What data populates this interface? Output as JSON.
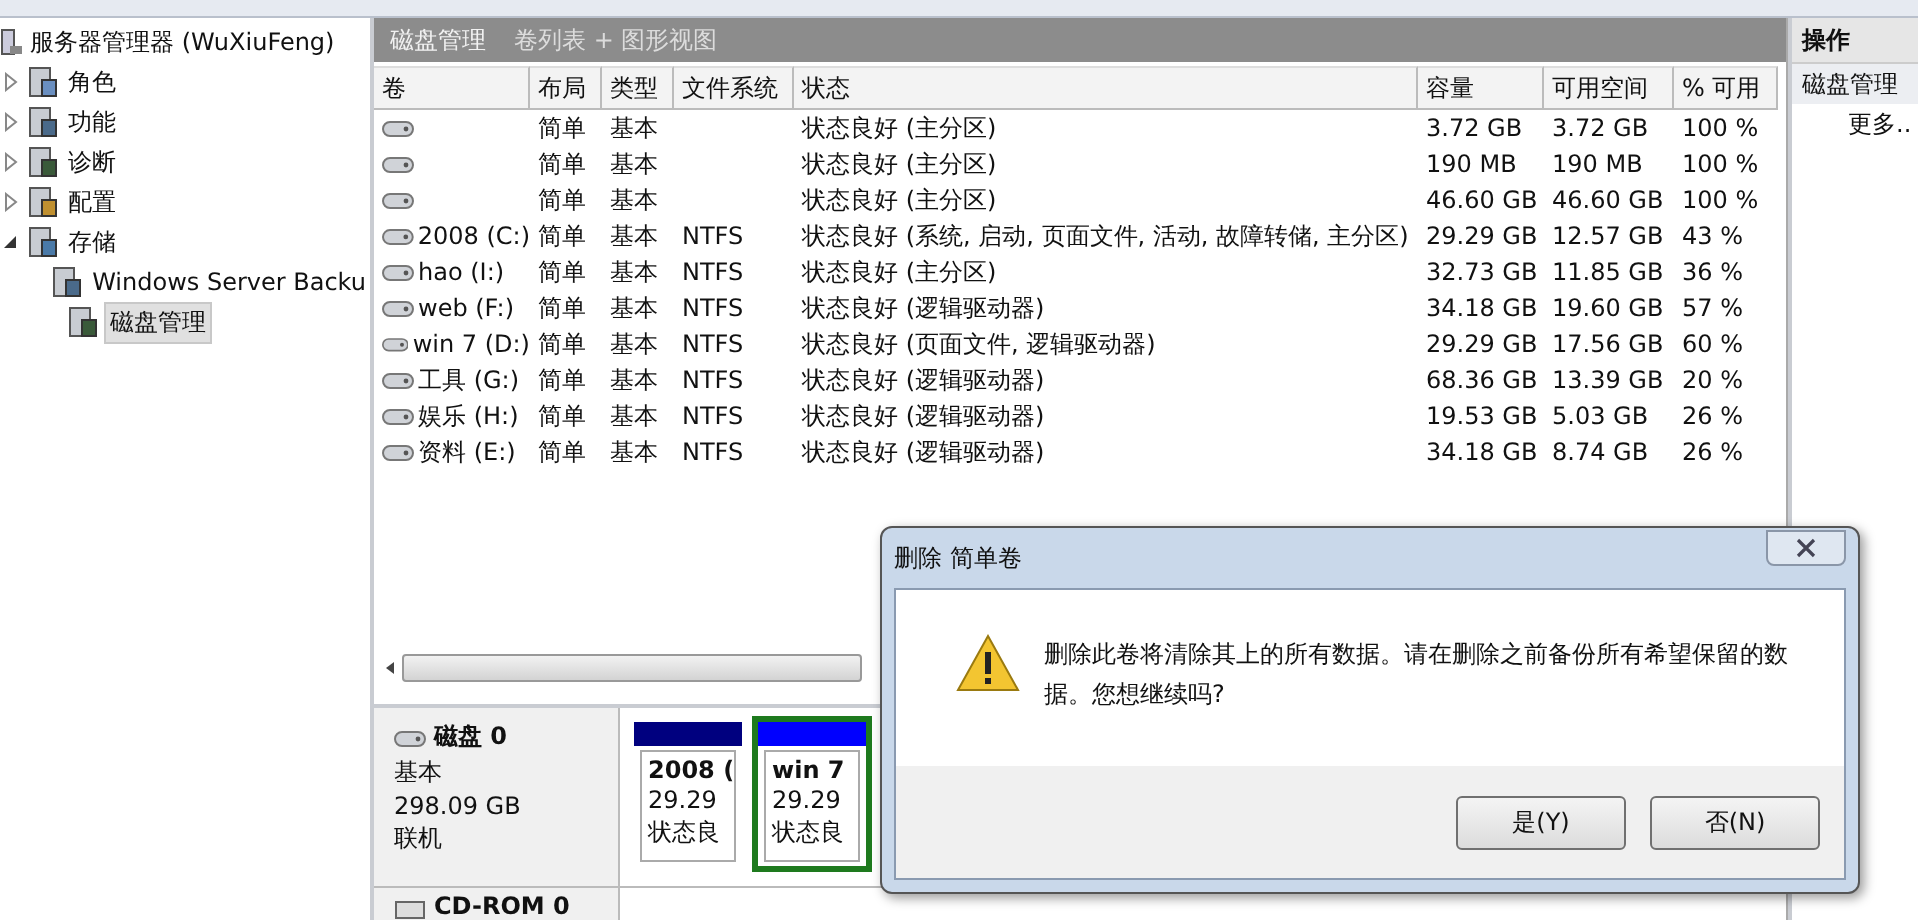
{
  "tree": {
    "root": "服务器管理器 (WuXiuFeng)",
    "items": [
      {
        "label": "角色",
        "expanded": false,
        "selected": false
      },
      {
        "label": "功能",
        "expanded": false,
        "selected": false
      },
      {
        "label": "诊断",
        "expanded": false,
        "selected": false
      },
      {
        "label": "配置",
        "expanded": false,
        "selected": false
      },
      {
        "label": "存储",
        "expanded": true,
        "selected": false,
        "children": [
          {
            "label": "Windows Server Backu",
            "selected": false
          },
          {
            "label": "磁盘管理",
            "selected": true
          }
        ]
      }
    ]
  },
  "panel": {
    "title": "磁盘管理",
    "subtitle": "卷列表 + 图形视图"
  },
  "table": {
    "columns": [
      "卷",
      "布局",
      "类型",
      "文件系统",
      "状态",
      "容量",
      "可用空间",
      "% 可用"
    ],
    "rows": [
      {
        "layout": "简单",
        "type": "基本",
        "status": "状态良好 (主分区)",
        "capacity": "3.72 GB",
        "free": "3.72 GB",
        "pct_free": "100 %"
      },
      {
        "layout": "简单",
        "type": "基本",
        "status": "状态良好 (主分区)",
        "capacity": "190 MB",
        "free": "190 MB",
        "pct_free": "100 %"
      },
      {
        "layout": "简单",
        "type": "基本",
        "status": "状态良好 (主分区)",
        "capacity": "46.60 GB",
        "free": "46.60 GB",
        "pct_free": "100 %"
      },
      {
        "volume": "2008 (C:)",
        "layout": "简单",
        "type": "基本",
        "fs": "NTFS",
        "status": "状态良好 (系统, 启动, 页面文件, 活动, 故障转储, 主分区)",
        "capacity": "29.29 GB",
        "free": "12.57 GB",
        "pct_free": "43 %"
      },
      {
        "volume": "hao (I:)",
        "layout": "简单",
        "type": "基本",
        "fs": "NTFS",
        "status": "状态良好 (主分区)",
        "capacity": "32.73 GB",
        "free": "11.85 GB",
        "pct_free": "36 %"
      },
      {
        "volume": "web (F:)",
        "layout": "简单",
        "type": "基本",
        "fs": "NTFS",
        "status": "状态良好 (逻辑驱动器)",
        "capacity": "34.18 GB",
        "free": "19.60 GB",
        "pct_free": "57 %"
      },
      {
        "volume": "win 7 (D:)",
        "layout": "简单",
        "type": "基本",
        "fs": "NTFS",
        "status": "状态良好 (页面文件, 逻辑驱动器)",
        "capacity": "29.29 GB",
        "free": "17.56 GB",
        "pct_free": "60 %"
      },
      {
        "volume": "工具 (G:)",
        "layout": "简单",
        "type": "基本",
        "fs": "NTFS",
        "status": "状态良好 (逻辑驱动器)",
        "capacity": "68.36 GB",
        "free": "13.39 GB",
        "pct_free": "20 %"
      },
      {
        "volume": "娱乐 (H:)",
        "layout": "简单",
        "type": "基本",
        "fs": "NTFS",
        "status": "状态良好 (逻辑驱动器)",
        "capacity": "19.53 GB",
        "free": "5.03 GB",
        "pct_free": "26 %"
      },
      {
        "volume": "资料 (E:)",
        "layout": "简单",
        "type": "基本",
        "fs": "NTFS",
        "status": "状态良好 (逻辑驱动器)",
        "capacity": "34.18 GB",
        "free": "8.74 GB",
        "pct_free": "26 %"
      }
    ]
  },
  "disks": [
    {
      "name": "磁盘 0",
      "type": "基本",
      "size": "298.09 GB",
      "status": "联机",
      "partitions": [
        {
          "name": "2008 (",
          "size": "29.29",
          "status": "状态良",
          "color": "#00007f",
          "selected": false
        },
        {
          "name": "win 7",
          "size": "29.29",
          "status": "状态良",
          "color": "#0000ff",
          "selected": true
        }
      ]
    },
    {
      "name": "CD-ROM 0"
    }
  ],
  "actions": {
    "title": "操作",
    "section": "磁盘管理",
    "items": [
      "更多.."
    ]
  },
  "dialog": {
    "title": "删除 简单卷",
    "message": "删除此卷将清除其上的所有数据。请在删除之前备份所有希望保留的数据。您想继续吗?",
    "buttons": [
      "是(Y)",
      "否(N)"
    ]
  }
}
